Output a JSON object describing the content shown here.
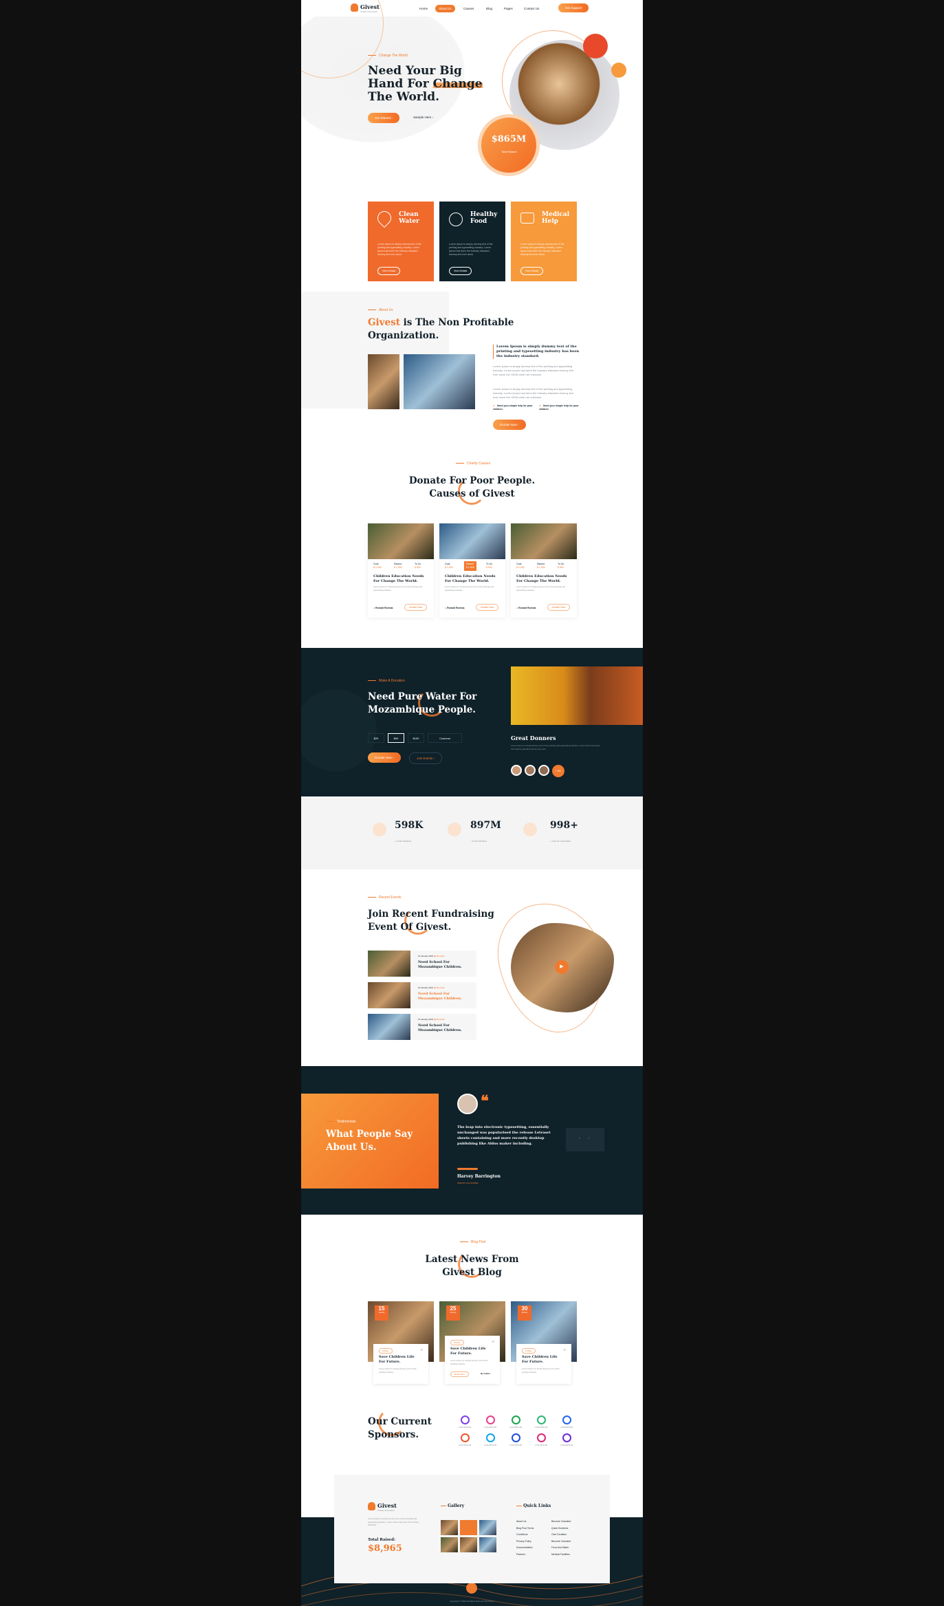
{
  "brand": {
    "name": "Givest",
    "tagline": "Charity & Donation"
  },
  "nav": {
    "links": [
      "Home",
      "About Us",
      "Causes",
      "Blog",
      "Pages",
      "Contact Us"
    ],
    "cta": "Get Support"
  },
  "hero": {
    "subtitle": "Change The World",
    "title_l1": "Need Your Big",
    "title_l2a": "Hand For ",
    "title_l2b": "Change",
    "title_l3": "The World.",
    "btn_primary": "Get Started",
    "btn_secondary": "Sample Here",
    "raised_amount": "$865M",
    "raised_label": "Total Raised"
  },
  "services": [
    {
      "title_l1": "Clean",
      "title_l2": "Water",
      "text": "Lorem Ipsum is simply dummy text of the printing and typesetting industry. Lorem Ipsum has been the industry standard dummy text ever since.",
      "btn": "View Details",
      "bg": "#f06a2c",
      "icon": "water-drop-icon"
    },
    {
      "title_l1": "Healthy",
      "title_l2": "Food",
      "text": "Lorem Ipsum is simply dummy text of the printing and typesetting industry. Lorem Ipsum has been the industry standard dummy text ever since.",
      "btn": "View Details",
      "bg": "#0f2129",
      "icon": "food-bowl-icon"
    },
    {
      "title_l1": "Medical",
      "title_l2": "Help",
      "text": "Lorem Ipsum is simply dummy text of the printing and typesetting industry. Lorem Ipsum has been the industry standard dummy text ever since.",
      "btn": "View Details",
      "bg": "#f79a3b",
      "icon": "medical-kit-icon"
    }
  ],
  "about": {
    "subtitle": "About Us",
    "title_brand": "Givest",
    "title_rest": " is The Non Profitable",
    "title_l2": "Organization.",
    "lead": "Lorem Ipsum is simply dummy text of the printing and typesetting industry has been the industry standard.",
    "p1": "Lorem Ipsum is simply dummy text of the printing and typesetting industry. Lorem Ipsum has been the industry standard dummy text ever since the 1500s when an unknown.",
    "p2": "Lorem Ipsum is simply dummy text of the printing and typesetting industry. Lorem Ipsum has been the industry standard dummy text ever since the 1500s when an unknown.",
    "check1": "Need your simple help for poor children.",
    "check2": "Need your simple help for poor children.",
    "btn": "Donate Now"
  },
  "causes": {
    "subtitle": "Charity Causes",
    "title_l1": "Donate For Poor People.",
    "title_l2": "Causes of Givest",
    "items": [
      {
        "goal_label": "Goal",
        "goal": "$ 2,000",
        "raised_label": "Raised",
        "raised": "$ 1,500",
        "to_go_label": "To Go",
        "to_go": "$ 500",
        "title_l1": "Children Education Needs",
        "title_l2": "For Change The World.",
        "text": "Lorem Ipsum is simply dummy text of the printing and typesetting industry.",
        "author": "Ronald Rochas",
        "btn": "Donate Now"
      },
      {
        "goal_label": "Goal",
        "goal": "$ 2,000",
        "raised_label": "Raised",
        "raised": "$ 1,500",
        "to_go_label": "To Go",
        "to_go": "$ 500",
        "title_l1": "Children Education Needs",
        "title_l2": "For Change The World.",
        "text": "Lorem Ipsum is simply dummy text of the printing and typesetting industry.",
        "author": "Ronald Rochas",
        "btn": "Donate Now"
      },
      {
        "goal_label": "Goal",
        "goal": "$ 2,000",
        "raised_label": "Raised",
        "raised": "$ 1,500",
        "to_go_label": "To Go",
        "to_go": "$ 500",
        "title_l1": "Children Education Needs",
        "title_l2": "For Change The World.",
        "text": "Lorem Ipsum is simply dummy text of the printing and typesetting industry.",
        "author": "Ronald Rochas",
        "btn": "Donate Now"
      }
    ]
  },
  "water": {
    "subtitle": "Make A Donation",
    "title_l1": "Need Pure Water For",
    "title_l2": "Mozambique People.",
    "amounts": [
      "$25",
      "$50",
      "$100",
      "Customs"
    ],
    "btn_primary": "Donate Now",
    "btn_secondary": "Join Events",
    "donors_title": "Great Donners",
    "donors_text": "Lorem Ipsum is simply dummy text of the printing and typesetting industry. Lorem Ipsum has been the industry standard dummy text ever.",
    "donors_more": "+ 45+"
  },
  "stats": [
    {
      "num": "598K",
      "label": "+ FOOD PEOPLE"
    },
    {
      "num": "897M",
      "label": "+ FOOD PEOPLE"
    },
    {
      "num": "998+",
      "label": "+ LIFE OF CHILDREN"
    }
  ],
  "events": {
    "subtitle": "Recent Events",
    "title_l1": "Join Recent Fundraising",
    "title_l2": "Event Of Givest.",
    "items": [
      {
        "date": "15 January 2021",
        "place": "Mountain",
        "title_l1": "Need School For",
        "title_l2": "Mozambique Children."
      },
      {
        "date": "15 January 2021",
        "place": "Mountain",
        "title_l1": "Need School For",
        "title_l2": "Mozambique Children."
      },
      {
        "date": "15 January 2021",
        "place": "Mountain",
        "title_l1": "Need School For",
        "title_l2": "Mozambique Children."
      }
    ]
  },
  "testimonial": {
    "subtitle": "Testimonials",
    "title_l1": "What People Say",
    "title_l2": "About Us.",
    "quote": "The leap into electronic typesetting, essentially unchanged was popularised the release Letraset sheets containing and more recently desktop publishing like Aldus maker including.",
    "name": "Harvey Barrington",
    "role": "SENIOR VOLUNTEER"
  },
  "blog": {
    "subtitle": "Blog Post",
    "title_l1": "Latest News From",
    "title_l2": "Givest Blog",
    "items": [
      {
        "day": "15",
        "month": "January",
        "tag": "Charity",
        "title_l1": "Save Children Life",
        "title_l2": "For Future.",
        "text": "Lorem Ipsum is simply dummy text of the printing industry."
      },
      {
        "day": "25",
        "month": "January",
        "tag": "Charity",
        "title_l1": "Save Children Life",
        "title_l2": "For Future.",
        "text": "Lorem Ipsum is simply dummy text of the printing industry.",
        "btn": "Read More",
        "author": "By Admin"
      },
      {
        "day": "30",
        "month": "January",
        "tag": "Charity",
        "title_l1": "Save Children Life",
        "title_l2": "For Future.",
        "text": "Lorem Ipsum is simply dummy text of the printing industry."
      }
    ]
  },
  "sponsors": {
    "title_l1": "Our Current",
    "title_l2": "Sponsors.",
    "logos": [
      {
        "name": "LOGOIPSUM",
        "color": "#7b3fe4"
      },
      {
        "name": "LOGOIPSUM",
        "color": "#e83e8c"
      },
      {
        "name": "LOGOIPSUM",
        "color": "#1aa34a"
      },
      {
        "name": "LOGOIPSUM",
        "color": "#2bb673"
      },
      {
        "name": "LOGOIPSUM",
        "color": "#2563eb"
      },
      {
        "name": "LOGOIPSUM",
        "color": "#f2542d"
      },
      {
        "name": "LOGOIPSUM",
        "color": "#0ea5e9"
      },
      {
        "name": "LOGOIPSUM",
        "color": "#1d4ed8"
      },
      {
        "name": "LOGOIPSUM",
        "color": "#db2777"
      },
      {
        "name": "LOGOIPSUM",
        "color": "#6d28d9"
      }
    ]
  },
  "footer": {
    "about": "Lorem Ipsum is simply dummy text of the printing and typesetting industry. Lorem Ipsum has been the industry standard.",
    "raised_label": "Total Raised:",
    "raised": "$8,965",
    "gallery_title": "Gallery",
    "links_title": "Quick Links",
    "links_col1": [
      "About Us",
      "Blog Post Terms",
      "Conditions",
      "Privacy Policy",
      "Documentation",
      "Partners"
    ],
    "links_col2": [
      "Become Volunteer",
      "Quick Solutions",
      "Give Donation",
      "Become Volunteer",
      "Food And Water",
      "Medical Facilities"
    ],
    "copyright": "Copyright © 2021 All Rights Reserved By Givest"
  },
  "colors": {
    "accent": "#f07a2e",
    "dark": "#0f2129"
  }
}
